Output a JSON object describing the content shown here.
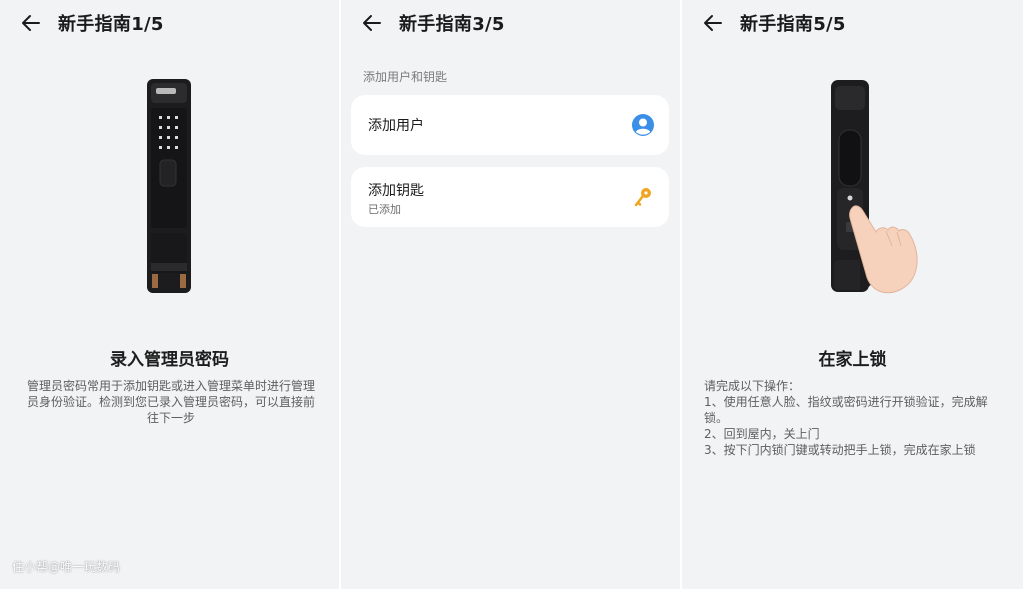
{
  "panels": [
    {
      "header": {
        "title": "新手指南1/5"
      },
      "heading": "录入管理员密码",
      "description": "管理员密码常用于添加钥匙或进入管理菜单时进行管理员身份验证。检测到您已录入管理员密码，可以直接前往下一步"
    },
    {
      "header": {
        "title": "新手指南3/5"
      },
      "section_label": "添加用户和钥匙",
      "cards": [
        {
          "title": "添加用户",
          "subtitle": "",
          "icon": "user-avatar-icon"
        },
        {
          "title": "添加钥匙",
          "subtitle": "已添加",
          "icon": "key-icon"
        }
      ]
    },
    {
      "header": {
        "title": "新手指南5/5"
      },
      "heading": "在家上锁",
      "instructions": [
        "请完成以下操作：",
        "1、使用任意人脸、指纹或密码进行开锁验证，完成解锁。",
        "2、回到屋内，关上门",
        "3、按下门内锁门键或转动把手上锁，完成在家上锁"
      ]
    }
  ],
  "watermark": "住小帮@唯一玩数码",
  "colors": {
    "panel_bg": "#f1f3f5",
    "card_bg": "#ffffff",
    "user_icon": "#3b8fe6",
    "key_icon": "#f0a420"
  }
}
